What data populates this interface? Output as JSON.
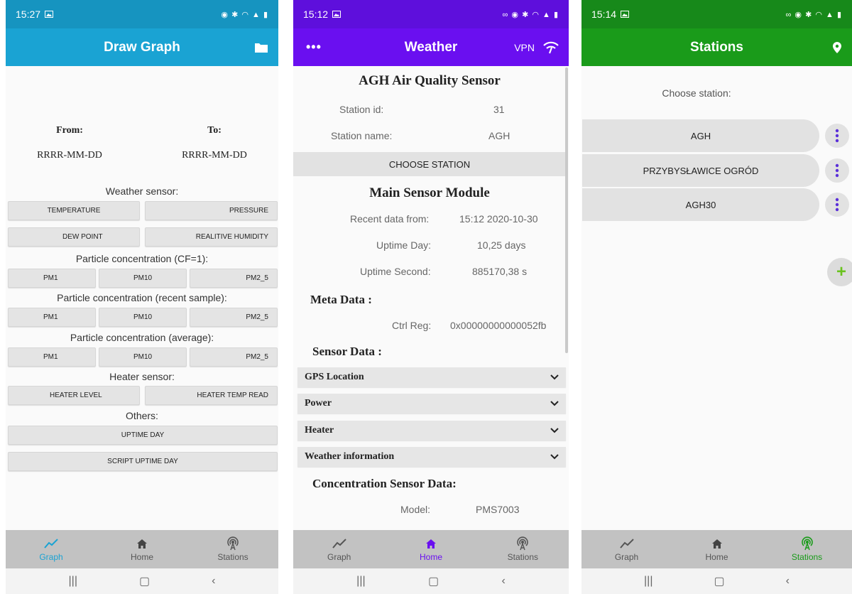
{
  "graph_screen": {
    "status_time": "15:27",
    "title": "Draw Graph",
    "from_label": "From:",
    "to_label": "To:",
    "from_value": "RRRR-MM-DD",
    "to_value": "RRRR-MM-DD",
    "sections": {
      "weather": "Weather sensor:",
      "cf1": "Particle concentration (CF=1):",
      "recent": "Particle concentration (recent sample):",
      "average": "Particle concentration (average):",
      "heater": "Heater sensor:",
      "others": "Others:"
    },
    "buttons": {
      "temperature": "TEMPERATURE",
      "pressure": "PRESSURE",
      "dew_point": "DEW POINT",
      "humidity": "REALITIVE HUMIDITY",
      "pm1": "PM1",
      "pm10": "PM10",
      "pm2_5": "PM2_5",
      "heater_level": "HEATER LEVEL",
      "heater_temp": "HEATER TEMP READ",
      "uptime_day": "UPTIME DAY",
      "script_uptime": "SCRIPT UPTIME DAY"
    },
    "accent": "#1aa3d3"
  },
  "weather_screen": {
    "status_time": "15:12",
    "title": "Weather",
    "vpn_label": "VPN",
    "sensor_title": "AGH Air Quality Sensor",
    "station_id_label": "Station id:",
    "station_id_value": "31",
    "station_name_label": "Station name:",
    "station_name_value": "AGH",
    "choose_station": "CHOOSE STATION",
    "module_title": "Main Sensor Module",
    "recent_label": "Recent data from:",
    "recent_value": "15:12  2020-10-30",
    "uptime_day_label": "Uptime Day:",
    "uptime_day_value": "10,25 days",
    "uptime_sec_label": "Uptime Second:",
    "uptime_sec_value": "885170,38 s",
    "meta_label": "Meta Data :",
    "ctrl_label": "Ctrl Reg:",
    "ctrl_value": "0x00000000000052fb",
    "sensor_data_label": "Sensor Data :",
    "expanders": [
      "GPS Location",
      "Power",
      "Heater",
      "Weather information"
    ],
    "conc_label": "Concentration Sensor Data:",
    "model_label": "Model:",
    "model_value": "PMS7003",
    "accent": "#6a0ff0"
  },
  "stations_screen": {
    "status_time": "15:14",
    "title": "Stations",
    "choose_label": "Choose station:",
    "stations": [
      "AGH",
      "PRZYBYSŁAWICE OGRÓD",
      "AGH30"
    ],
    "accent": "#1a9b1a"
  },
  "bottom_nav": {
    "graph": "Graph",
    "home": "Home",
    "stations": "Stations"
  }
}
